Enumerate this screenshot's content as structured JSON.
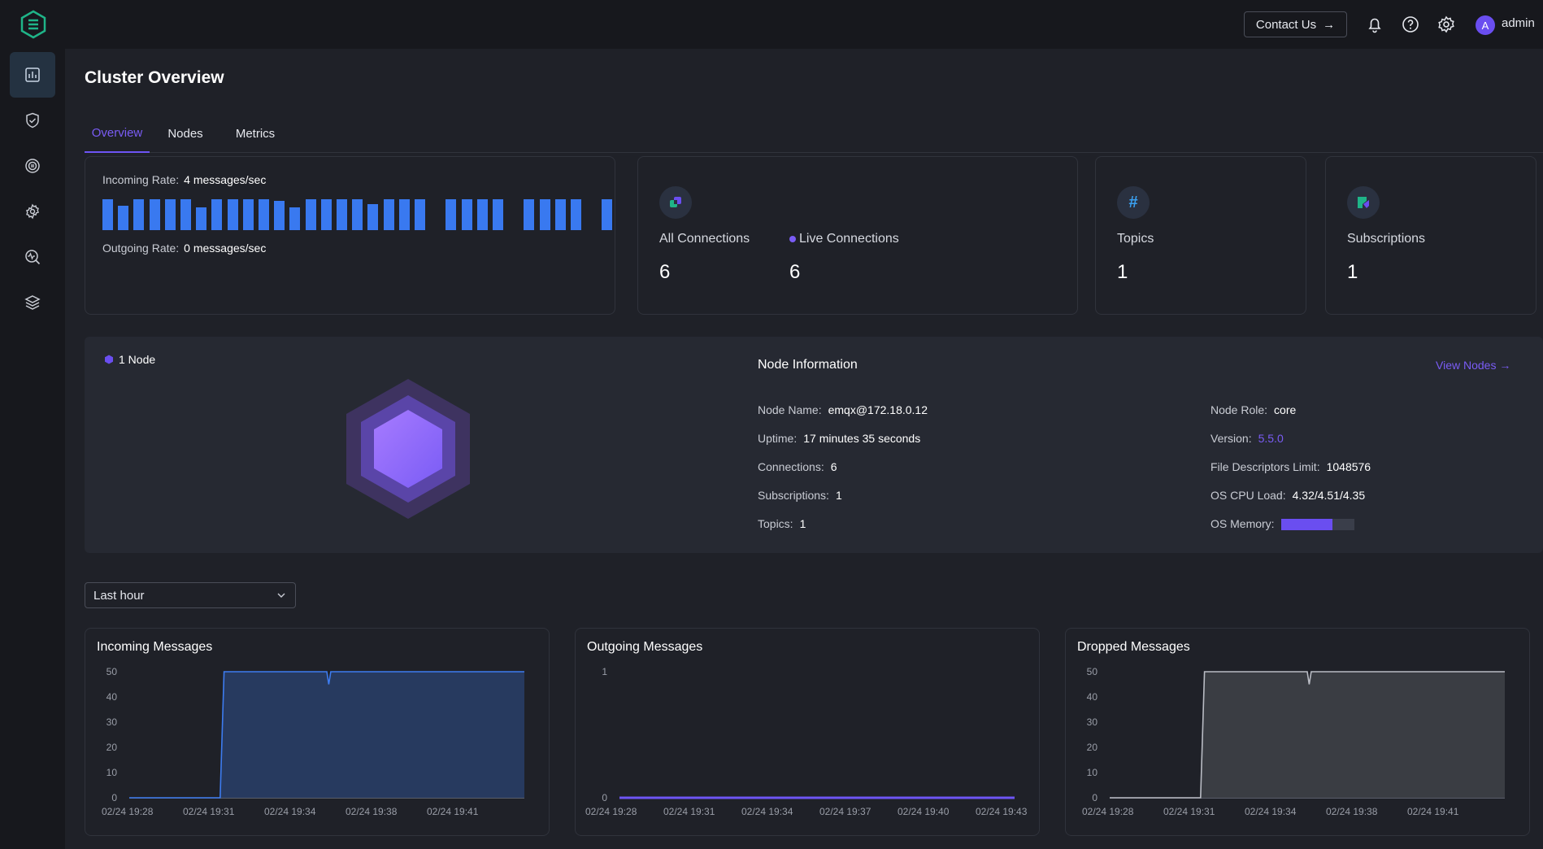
{
  "header": {
    "contact_label": "Contact Us",
    "user": {
      "avatar_letter": "A",
      "name": "admin"
    },
    "icons": [
      "bell-icon",
      "help-icon",
      "settings-icon"
    ]
  },
  "sidebar": {
    "items": [
      {
        "icon": "dashboard-icon",
        "active": true
      },
      {
        "icon": "shield-icon",
        "active": false
      },
      {
        "icon": "integration-icon",
        "active": false
      },
      {
        "icon": "management-icon",
        "active": false
      },
      {
        "icon": "diagnose-icon",
        "active": false
      },
      {
        "icon": "layers-icon",
        "active": false
      }
    ]
  },
  "page": {
    "title": "Cluster Overview",
    "tabs": [
      {
        "label": "Overview",
        "active": true
      },
      {
        "label": "Nodes",
        "active": false
      },
      {
        "label": "Metrics",
        "active": false
      }
    ]
  },
  "rates": {
    "incoming_label": "Incoming Rate:",
    "incoming_value": "4 messages/sec",
    "outgoing_label": "Outgoing Rate:",
    "outgoing_value": "0 messages/sec",
    "bars": [
      1,
      0.8,
      1,
      1,
      1,
      1,
      0.75,
      1,
      1,
      1,
      1,
      0.95,
      0.75,
      1,
      1,
      1,
      1,
      0.85,
      1,
      1,
      1,
      0,
      1,
      1,
      1,
      1,
      0,
      1,
      1,
      1,
      1,
      0,
      1
    ]
  },
  "stats": {
    "all_connections_label": "All Connections",
    "all_connections_value": "6",
    "live_connections_label": "Live Connections",
    "live_connections_value": "6",
    "topics_label": "Topics",
    "topics_value": "1",
    "subscriptions_label": "Subscriptions",
    "subscriptions_value": "1"
  },
  "node": {
    "count_label": "1 Node",
    "info_title": "Node Information",
    "view_nodes_label": "View Nodes",
    "left": [
      {
        "label": "Node Name:",
        "value": "emqx@172.18.0.12"
      },
      {
        "label": "Uptime:",
        "value": "17 minutes 35 seconds"
      },
      {
        "label": "Connections:",
        "value": "6"
      },
      {
        "label": "Subscriptions:",
        "value": "1"
      },
      {
        "label": "Topics:",
        "value": "1"
      }
    ],
    "right": [
      {
        "label": "Node Role:",
        "value": "core"
      },
      {
        "label": "Version:",
        "value": "5.5.0"
      },
      {
        "label": "File Descriptors Limit:",
        "value": "1048576"
      },
      {
        "label": "OS CPU Load:",
        "value": "4.32/4.51/4.35"
      },
      {
        "label": "OS Memory:",
        "value": ""
      }
    ],
    "os_memory_fraction": 0.7
  },
  "time_range": {
    "selected": "Last hour"
  },
  "colors": {
    "accent": "#6e55f5",
    "bar": "#3979f0",
    "incoming": "#3d7cf0",
    "outgoing": "#6e55f5",
    "dropped": "#b9bcc4"
  },
  "chart_data": [
    {
      "type": "area",
      "title": "Incoming Messages",
      "ylim": [
        0,
        50
      ],
      "yticks": [
        0,
        10,
        20,
        30,
        40,
        50
      ],
      "xticks": [
        "02/24 19:28",
        "02/24 19:31",
        "02/24 19:34",
        "02/24 19:38",
        "02/24 19:41"
      ],
      "x": [
        0,
        0.23,
        0.24,
        0.5,
        0.505,
        0.51,
        1
      ],
      "y": [
        0,
        0,
        50,
        50,
        45,
        50,
        50
      ]
    },
    {
      "type": "line",
      "title": "Outgoing Messages",
      "ylim": [
        0,
        1
      ],
      "yticks": [
        0,
        1
      ],
      "xticks": [
        "02/24 19:28",
        "02/24 19:31",
        "02/24 19:34",
        "02/24 19:37",
        "02/24 19:40",
        "02/24 19:43"
      ],
      "x": [
        0,
        1
      ],
      "y": [
        0,
        0
      ]
    },
    {
      "type": "area",
      "title": "Dropped Messages",
      "ylim": [
        0,
        50
      ],
      "yticks": [
        0,
        10,
        20,
        30,
        40,
        50
      ],
      "xticks": [
        "02/24 19:28",
        "02/24 19:31",
        "02/24 19:34",
        "02/24 19:38",
        "02/24 19:41"
      ],
      "x": [
        0,
        0.23,
        0.24,
        0.5,
        0.505,
        0.51,
        1
      ],
      "y": [
        0,
        0,
        50,
        50,
        45,
        50,
        50
      ]
    }
  ]
}
